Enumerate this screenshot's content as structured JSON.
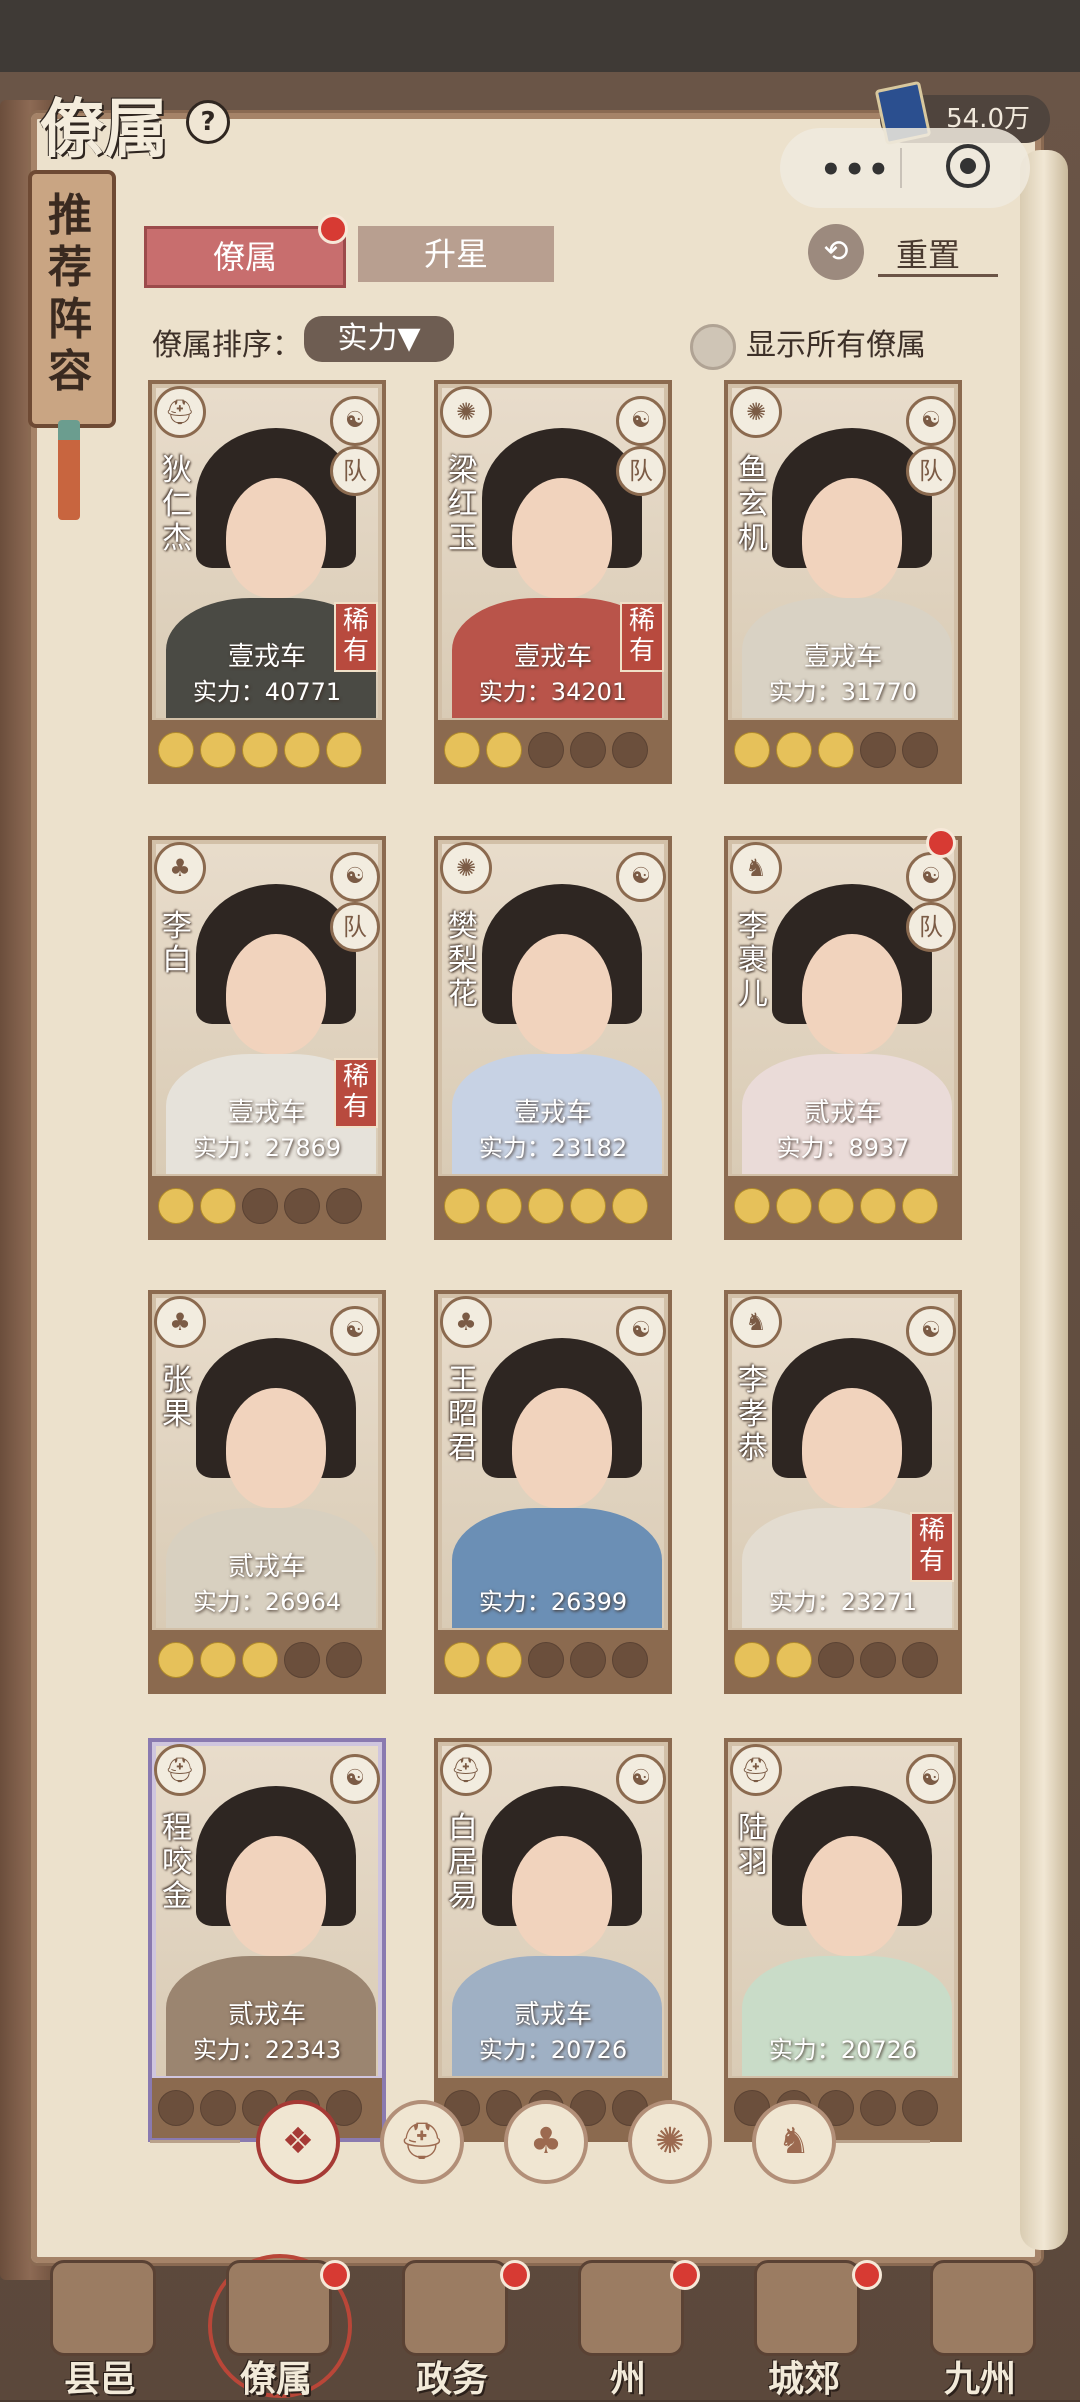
{
  "header": {
    "title": "僚属",
    "help_label": "?",
    "currency": "54.0万"
  },
  "mini_program": {
    "dots_label": "•••"
  },
  "recommend_banner": {
    "label": "推荐阵容"
  },
  "tabs": [
    {
      "label": "僚属",
      "active": true
    },
    {
      "label": "升星",
      "active": false
    }
  ],
  "reset_label": "重置",
  "sort": {
    "label": "僚属排序：",
    "value": "实力▼"
  },
  "show_all": {
    "label": "显示所有僚属",
    "checked": false
  },
  "cards": [
    {
      "name": "狄仁杰",
      "car": "壹戎车",
      "power": "实力：40771",
      "rare": "稀有",
      "stars_on": 5,
      "badge2": "队"
    },
    {
      "name": "梁红玉",
      "car": "壹戎车",
      "power": "实力：34201",
      "rare": "稀有",
      "stars_on": 2,
      "badge2": "队"
    },
    {
      "name": "鱼玄机",
      "car": "壹戎车",
      "power": "实力：31770",
      "rare": "",
      "stars_on": 3,
      "badge2": "队"
    },
    {
      "name": "李白",
      "car": "壹戎车",
      "power": "实力：27869",
      "rare": "稀有",
      "stars_on": 2,
      "badge2": "队"
    },
    {
      "name": "樊梨花",
      "car": "壹戎车",
      "power": "实力：23182",
      "rare": "",
      "stars_on": 5,
      "badge2": ""
    },
    {
      "name": "李裹儿",
      "car": "贰戎车",
      "power": "实力：8937",
      "rare": "",
      "stars_on": 5,
      "badge2": "队"
    },
    {
      "name": "张果",
      "car": "贰戎车",
      "power": "实力：26964",
      "rare": "",
      "stars_on": 3,
      "badge2": ""
    },
    {
      "name": "王昭君",
      "car": "",
      "power": "实力：26399",
      "rare": "",
      "stars_on": 2,
      "badge2": ""
    },
    {
      "name": "李孝恭",
      "car": "",
      "power": "实力：23271",
      "rare": "稀有",
      "stars_on": 2,
      "badge2": ""
    },
    {
      "name": "程咬金",
      "car": "贰戎车",
      "power": "实力：22343",
      "rare": "",
      "stars_on": 0,
      "badge2": ""
    },
    {
      "name": "白居易",
      "car": "贰戎车",
      "power": "实力：20726",
      "rare": "",
      "stars_on": 0,
      "badge2": ""
    },
    {
      "name": "陆羽",
      "car": "",
      "power": "实力：20726",
      "rare": "",
      "stars_on": 0,
      "badge2": ""
    }
  ],
  "filters": [
    {
      "icon": "diamond-icon",
      "glyph": "❖"
    },
    {
      "icon": "helmet-icon",
      "glyph": "⛑"
    },
    {
      "icon": "gourd-icon",
      "glyph": "♣"
    },
    {
      "icon": "fan-icon",
      "glyph": "✺"
    },
    {
      "icon": "beast-icon",
      "glyph": "♞"
    }
  ],
  "nav": [
    {
      "label": "县邑"
    },
    {
      "label": "僚属",
      "active": true
    },
    {
      "label": "政务"
    },
    {
      "label": "州"
    },
    {
      "label": "城郊"
    },
    {
      "label": "九州"
    }
  ],
  "colors": {
    "accent_red": "#b84a3e",
    "tab_active": "#c86e6e",
    "star_on": "#e6c15a",
    "paper": "#ede3cf"
  }
}
